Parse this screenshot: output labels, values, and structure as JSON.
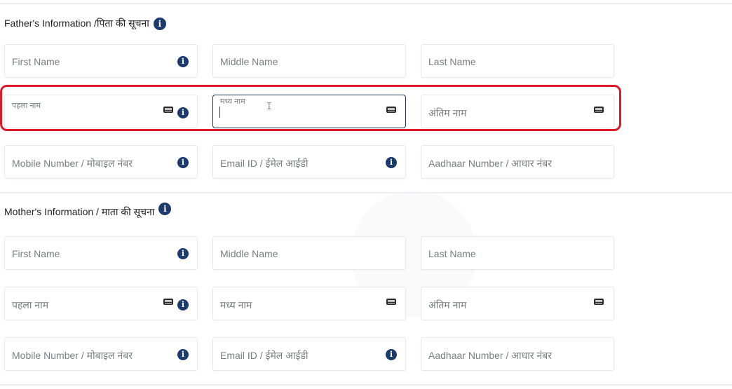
{
  "father": {
    "title": "Father's Information /पिता की सूचना",
    "first_name": "First Name",
    "middle_name": "Middle Name",
    "last_name": "Last Name",
    "first_name_hi": "पहला नाम",
    "middle_name_hi": "मध्य नाम",
    "last_name_hi": "अंतिम नाम",
    "mobile": "Mobile Number / मोबाइल नंबर",
    "email": "Email ID / ईमेल आईडी",
    "aadhaar": "Aadhaar Number / आधार नंबर"
  },
  "mother": {
    "title": "Mother's Information / माता की सूचना",
    "first_name": "First Name",
    "middle_name": "Middle Name",
    "last_name": "Last Name",
    "first_name_hi": "पहला नाम",
    "middle_name_hi": "मध्य नाम",
    "last_name_hi": "अंतिम नाम",
    "mobile": "Mobile Number / मोबाइल नंबर",
    "email": "Email ID / ईमेल आईडी",
    "aadhaar": "Aadhaar Number / आधार नंबर"
  },
  "icons": {
    "info": "info-icon",
    "keyboard": "keyboard-icon",
    "cursor": "text-cursor-icon"
  },
  "colors": {
    "highlight": "#e0192a",
    "info": "#1d3a6e",
    "active_border": "#1f3457"
  }
}
